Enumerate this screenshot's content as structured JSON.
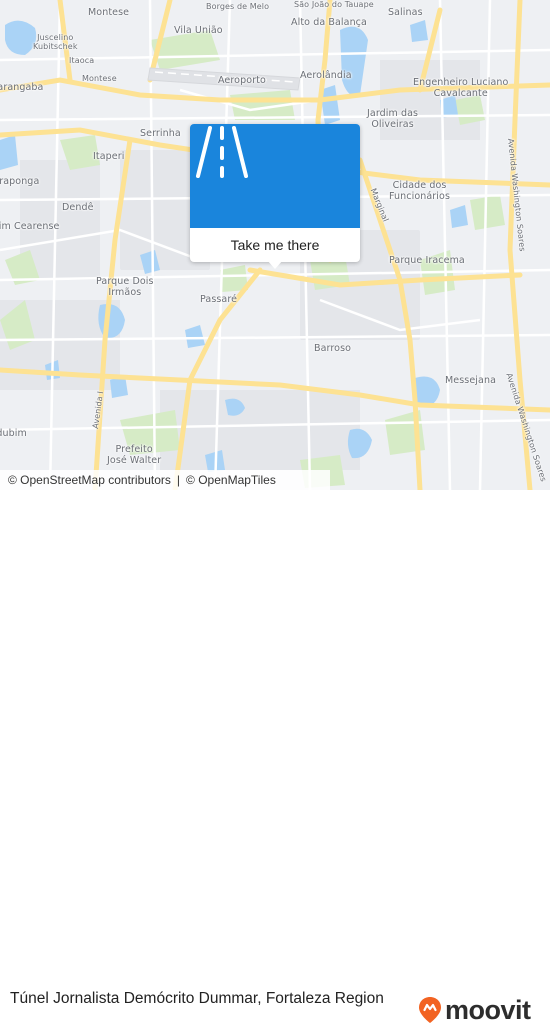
{
  "map": {
    "neighborhoods": [
      {
        "id": "montese_top",
        "label": "Montese"
      },
      {
        "id": "borges",
        "label": "Borges de Melo"
      },
      {
        "id": "sao_joao",
        "label": "São João do Tauape"
      },
      {
        "id": "salinas",
        "label": "Salinas"
      },
      {
        "id": "alto_balanca",
        "label": "Alto da Balança"
      },
      {
        "id": "juscelino",
        "label": "Juscelino\nKubitschek"
      },
      {
        "id": "vila_uniao",
        "label": "Vila União"
      },
      {
        "id": "itaoca",
        "label": "Itaoca"
      },
      {
        "id": "montese",
        "label": "Montese"
      },
      {
        "id": "aeroporto",
        "label": "Aeroporto"
      },
      {
        "id": "aerolandia",
        "label": "Aerolândia"
      },
      {
        "id": "engenheiro",
        "label": "Engenheiro Luciano\nCavalcante"
      },
      {
        "id": "parangaba",
        "label": "Parangaba"
      },
      {
        "id": "jardim_oliveiras",
        "label": "Jardim das\nOliveiras"
      },
      {
        "id": "serrinha",
        "label": "Serrinha"
      },
      {
        "id": "itaperi",
        "label": "Itaperi"
      },
      {
        "id": "maraponga",
        "label": "Maraponga"
      },
      {
        "id": "cidade_funcionarios",
        "label": "Cidade dos\nFuncionários"
      },
      {
        "id": "dende",
        "label": "Dendê"
      },
      {
        "id": "jardim_cearense",
        "label": "Jardim Cearense"
      },
      {
        "id": "parque_iracema",
        "label": "Parque Iracema"
      },
      {
        "id": "parque_dois_irmaos",
        "label": "Parque Dois\nIrmãos"
      },
      {
        "id": "passare",
        "label": "Passaré"
      },
      {
        "id": "barroso",
        "label": "Barroso"
      },
      {
        "id": "messejana",
        "label": "Messejana"
      },
      {
        "id": "prefeito_jose_walter",
        "label": "Prefeito\nJosé Walter"
      },
      {
        "id": "mondubim",
        "label": "Mondubim"
      }
    ],
    "roads": [
      {
        "id": "av_washington_soares_1",
        "label": "Avenida Washington Soares"
      },
      {
        "id": "av_washington_soares_2",
        "label": "Avenida Washington Soares"
      },
      {
        "id": "av_i",
        "label": "Avenida I"
      },
      {
        "id": "marginal",
        "label": "Marginal"
      }
    ],
    "colors": {
      "land": "#eef0f3",
      "block": "#e4e6ea",
      "road_major": "#fde293",
      "road_minor": "#ffffff",
      "water": "#aad3f6",
      "park": "#d6ebc6"
    }
  },
  "popup": {
    "icon": "road-icon",
    "button_label": "Take me there",
    "accent": "#1a85dc"
  },
  "attribution": {
    "osm": "© OpenStreetMap contributors",
    "omt": "© OpenMapTiles"
  },
  "footer": {
    "title": "Túnel Jornalista Demócrito Dummar, Fortaleza Region",
    "brand": "moovit",
    "brand_color": "#f26322"
  }
}
